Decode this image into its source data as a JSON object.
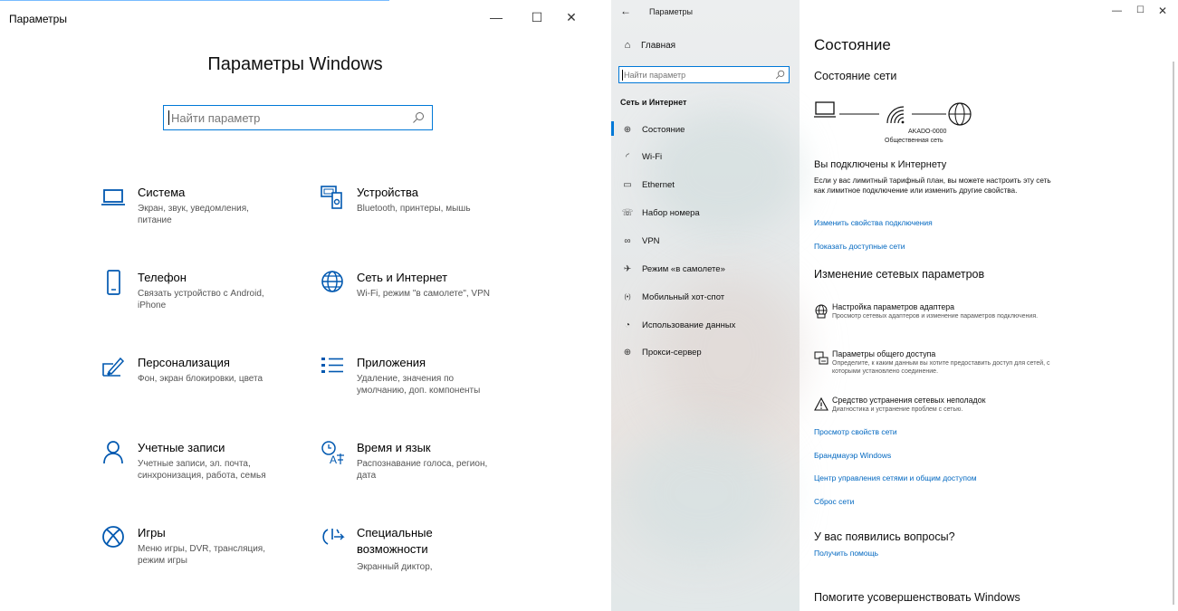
{
  "left_window": {
    "title": "Параметры",
    "controls": {
      "minimize": "—",
      "maximize": "☐",
      "close": "✕"
    },
    "heading": "Параметры Windows",
    "search": {
      "placeholder": "Найти параметр",
      "value": ""
    },
    "tiles": [
      {
        "name": "Система",
        "desc": "Экран, звук, уведомления, питание",
        "icon": "laptop-icon"
      },
      {
        "name": "Устройства",
        "desc": "Bluetooth, принтеры, мышь",
        "icon": "devices-icon"
      },
      {
        "name": "Телефон",
        "desc": "Связать устройство с Android, iPhone",
        "icon": "phone-icon"
      },
      {
        "name": "Сеть и Интернет",
        "desc": "Wi-Fi, режим \"в самолете\", VPN",
        "icon": "globe-icon"
      },
      {
        "name": "Персонализация",
        "desc": "Фон, экран блокировки, цвета",
        "icon": "brush-icon"
      },
      {
        "name": "Приложения",
        "desc": "Удаление, значения по умолчанию, доп. компоненты",
        "icon": "apps-icon"
      },
      {
        "name": "Учетные записи",
        "desc": "Учетные записи, эл. почта, синхронизация, работа, семья",
        "icon": "person-icon"
      },
      {
        "name": "Время и язык",
        "desc": "Распознавание голоса, регион, дата",
        "icon": "time-language-icon"
      },
      {
        "name": "Игры",
        "desc": "Меню игры, DVR, трансляция, режим игры",
        "icon": "xbox-icon"
      },
      {
        "name": "Специальные возможности",
        "desc": "Экранный диктор,",
        "icon": "accessibility-icon"
      }
    ]
  },
  "right_window": {
    "title": "Параметры",
    "back": "←",
    "controls": {
      "minimize": "—",
      "maximize": "☐",
      "close": "✕"
    },
    "sidebar": {
      "home": "Главная",
      "search_placeholder": "Найти параметр",
      "section": "Сеть и Интернет",
      "items": [
        {
          "label": "Состояние",
          "icon": "status-icon",
          "glyph": "⊕",
          "active": true
        },
        {
          "label": "Wi-Fi",
          "icon": "wifi-icon",
          "glyph": "◜",
          "active": false
        },
        {
          "label": "Ethernet",
          "icon": "ethernet-icon",
          "glyph": "▭",
          "active": false
        },
        {
          "label": "Набор номера",
          "icon": "dialup-icon",
          "glyph": "☏",
          "active": false
        },
        {
          "label": "VPN",
          "icon": "vpn-icon",
          "glyph": "∞",
          "active": false
        },
        {
          "label": "Режим «в самолете»",
          "icon": "airplane-icon",
          "glyph": "✈",
          "active": false
        },
        {
          "label": "Мобильный хот-спот",
          "icon": "hotspot-icon",
          "glyph": "(•)",
          "active": false
        },
        {
          "label": "Использование данных",
          "icon": "data-usage-icon",
          "glyph": "◔",
          "active": false
        },
        {
          "label": "Прокси-сервер",
          "icon": "proxy-icon",
          "glyph": "⊕",
          "active": false
        }
      ]
    },
    "content": {
      "title": "Состояние",
      "network_status_heading": "Состояние сети",
      "network_name": "AKADO-0000",
      "network_type": "Общественная сеть",
      "connected_heading": "Вы подключены к Интернету",
      "connected_text": "Если у вас лимитный тарифный план, вы можете настроить эту сеть как лимитное подключение или изменить другие свойства.",
      "link_change_props": "Изменить свойства подключения",
      "link_show_networks": "Показать доступные сети",
      "change_heading": "Изменение сетевых параметров",
      "options": [
        {
          "title": "Настройка параметров адаптера",
          "desc": "Просмотр сетевых адаптеров и изменение параметров подключения.",
          "icon": "adapter-icon"
        },
        {
          "title": "Параметры общего доступа",
          "desc": "Определите, к каким данным вы хотите предоставить доступ для сетей, с которыми установлено соединение.",
          "icon": "sharing-icon"
        },
        {
          "title": "Средство устранения сетевых неполадок",
          "desc": "Диагностика и устранение проблем с сетью.",
          "icon": "warning-icon"
        }
      ],
      "links": [
        "Просмотр свойств сети",
        "Брандмауэр Windows",
        "Центр управления сетями и общим доступом",
        "Сброс сети"
      ],
      "questions_heading": "У вас появились вопросы?",
      "help_link": "Получить помощь",
      "improve_heading": "Помогите усовершенствовать Windows"
    }
  },
  "colors": {
    "accent": "#0078d7",
    "link": "#0067c0"
  }
}
